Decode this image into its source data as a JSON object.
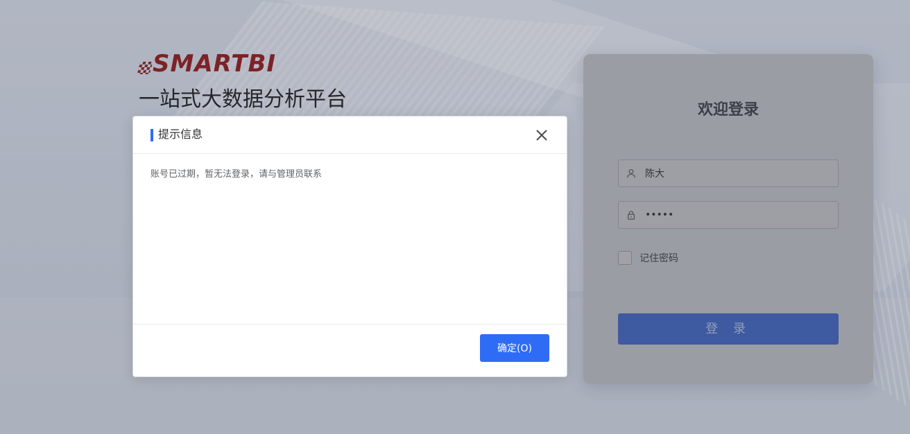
{
  "brand": {
    "logo_text": "SMARTBI",
    "tagline": "一站式大数据分析平台"
  },
  "login": {
    "title": "欢迎登录",
    "username_value": "陈大",
    "password_value": "•••••",
    "remember_label": "记住密码",
    "login_button": "登 录"
  },
  "dialog": {
    "title": "提示信息",
    "message": "账号已过期，暂无法登录，请与管理员联系",
    "ok_button": "确定(O)"
  },
  "icons": {
    "user": "user-icon",
    "lock": "lock-icon",
    "close": "close-icon"
  },
  "colors": {
    "brand_red": "#8f1a1a",
    "primary_blue": "#2f6cf6",
    "login_button_blue": "#3f62b8"
  }
}
